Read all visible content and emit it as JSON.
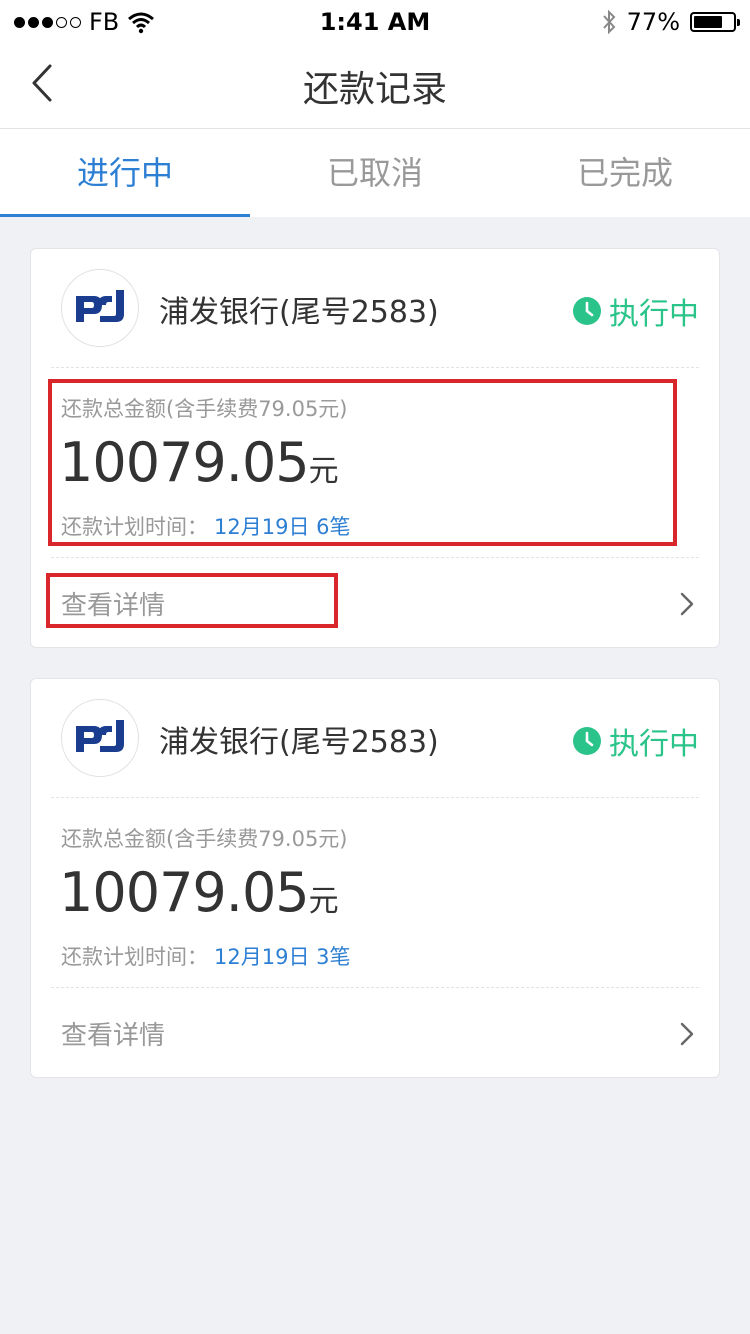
{
  "status_bar": {
    "carrier": "FB",
    "time": "1:41 AM",
    "battery_percent": "77%",
    "battery_level": 0.77
  },
  "nav": {
    "title": "还款记录"
  },
  "tabs": [
    {
      "label": "进行中",
      "active": true
    },
    {
      "label": "已取消",
      "active": false
    },
    {
      "label": "已完成",
      "active": false
    }
  ],
  "records": [
    {
      "bank_name": "浦发银行(尾号2583)",
      "status": "执行中",
      "amount_label": "还款总金额(含手续费79.05元)",
      "amount": "10079.05",
      "amount_unit": "元",
      "plan_label": "还款计划时间：",
      "plan_value": "12月19日 6笔",
      "detail_label": "查看详情"
    },
    {
      "bank_name": "浦发银行(尾号2583)",
      "status": "执行中",
      "amount_label": "还款总金额(含手续费79.05元)",
      "amount": "10079.05",
      "amount_unit": "元",
      "plan_label": "还款计划时间：",
      "plan_value": "12月19日 3笔",
      "detail_label": "查看详情"
    }
  ],
  "colors": {
    "accent": "#2d7fd3",
    "status_green": "#2ac48a",
    "highlight_red": "#d9262b",
    "bank_logo_blue": "#1a3d8f"
  },
  "icons": [
    "signal-dots-icon",
    "wifi-icon",
    "bluetooth-icon",
    "battery-icon",
    "back-arrow-icon",
    "bank-logo-icon",
    "clock-icon",
    "chevron-right-icon"
  ]
}
